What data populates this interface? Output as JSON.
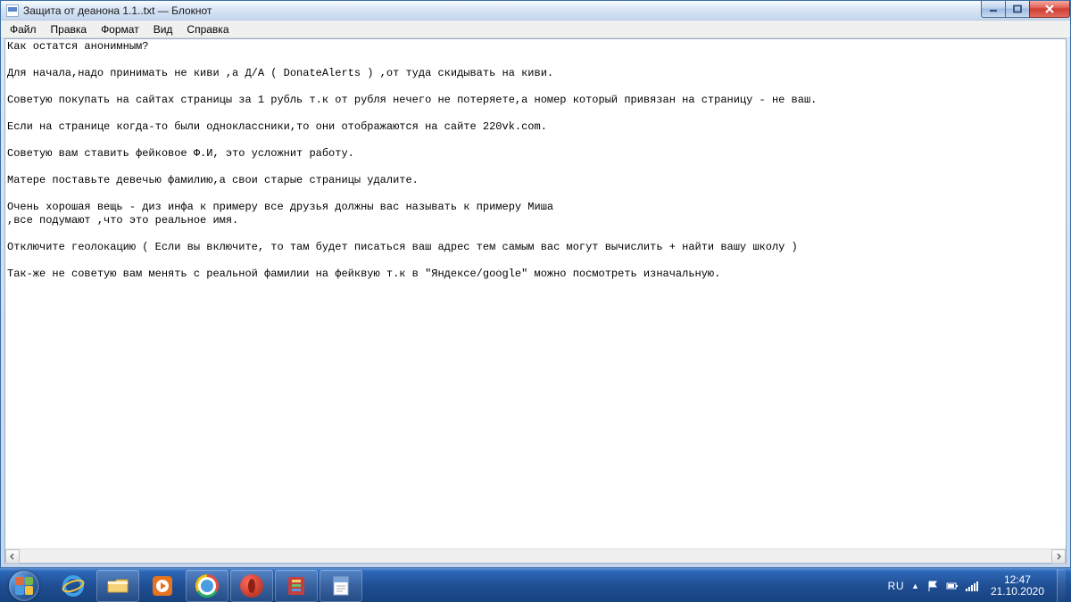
{
  "window": {
    "title": "Защита от деанона 1.1..txt — Блокнот"
  },
  "menu": {
    "file": "Файл",
    "edit": "Правка",
    "format": "Формат",
    "view": "Вид",
    "help": "Справка"
  },
  "content": {
    "l1": "Как остатся анонимным?",
    "l2": "Для начала,надо принимать не киви ,а Д/А ( DonateAlerts ) ,от туда скидывать на киви.",
    "l3": "Советую покупать на сайтах страницы за 1 рубль т.к от рубля нечего не потеряете,а номер который привязан на страницу - не ваш.",
    "l4": "Если на странице когда-то были одноклассники,то они отображаются на сайте 220vk.com.",
    "l5": "Советую вам ставить фейковое Ф.И, это усложнит работу.",
    "l6": "Матере поставьте девечью фамилию,а свои старые страницы удалите.",
    "l7a": "Очень хорошая вещь - диз инфа к примеру все друзья должны вас называть к примеру Миша",
    "l7b": ",все подумают ,что это реальное имя.",
    "l8": "Отключите геолокацию ( Если вы включите, то там будет писаться ваш адрес тем самым вас могут вычислить + найти вашу школу )",
    "l9": "Так-же не советую вам менять с реальной фамилии на фейквую т.к в \"Яндексе/google\" можно посмотреть изначальную."
  },
  "tray": {
    "lang": "RU",
    "time": "12:47",
    "date": "21.10.2020"
  }
}
